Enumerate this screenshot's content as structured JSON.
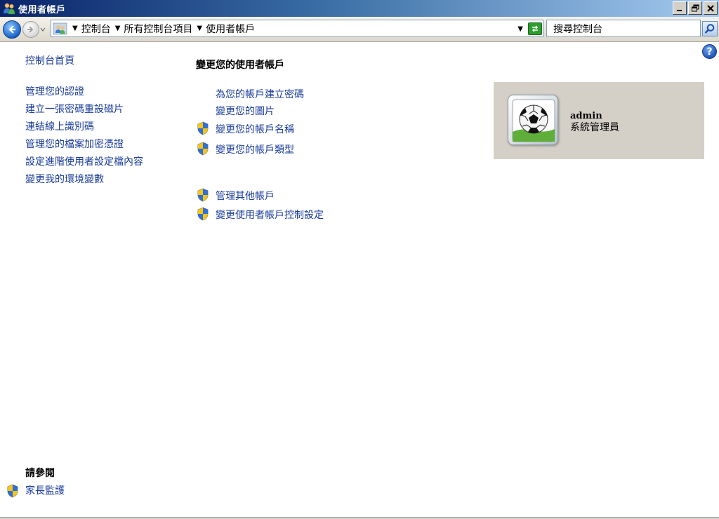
{
  "window": {
    "title": "使用者帳戶"
  },
  "address": {
    "crumbs": [
      "控制台",
      "所有控制台項目",
      "使用者帳戶"
    ],
    "search_placeholder": "搜尋控制台"
  },
  "sidebar": {
    "home": "控制台首頁",
    "items": [
      "管理您的認證",
      "建立一張密碼重設磁片",
      "連結線上識別碼",
      "管理您的檔案加密憑證",
      "設定進階使用者設定檔內容",
      "變更我的環境變數"
    ],
    "see_also_heading": "請參閱",
    "see_also_items": [
      "家長監護"
    ]
  },
  "main": {
    "heading": "變更您的使用者帳戶",
    "tasks": [
      "為您的帳戶建立密碼",
      "變更您的圖片",
      "變更您的帳戶名稱",
      "變更您的帳戶類型"
    ],
    "other_tasks": [
      "管理其他帳戶",
      "變更使用者帳戶控制設定"
    ]
  },
  "user": {
    "name": "admin",
    "role": "系統管理員"
  },
  "colors": {
    "link": "#1a3c9a",
    "tile_bg": "#d4d0c8",
    "title_bar_start": "#0a246a",
    "title_bar_end": "#a6caf0"
  }
}
